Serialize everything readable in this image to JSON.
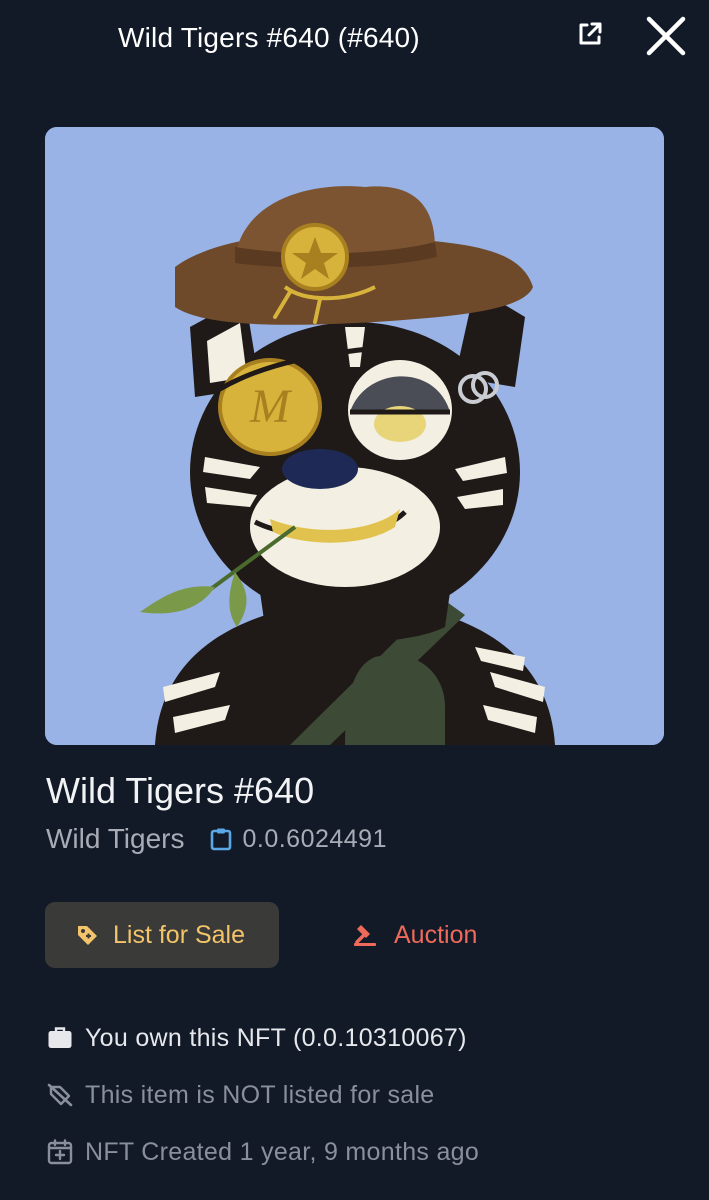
{
  "header": {
    "title": "Wild Tigers #640 (#640)",
    "external_icon": "external-link-icon",
    "close_icon": "close-icon"
  },
  "nft": {
    "name": "Wild Tigers #640",
    "collection": "Wild Tigers",
    "token_id": "0.0.6024491",
    "image_background": "#99b3e6"
  },
  "actions": {
    "list_for_sale": "List for Sale",
    "auction": "Auction"
  },
  "info": {
    "ownership": "You own this NFT (0.0.10310067)",
    "listing_status": "This item is NOT listed for sale",
    "created": "NFT Created 1 year, 9 months ago"
  },
  "colors": {
    "background": "#121a28",
    "list_accent": "#f4c46a",
    "auction_accent": "#ef6a5a",
    "muted_text": "#a7acb5"
  }
}
